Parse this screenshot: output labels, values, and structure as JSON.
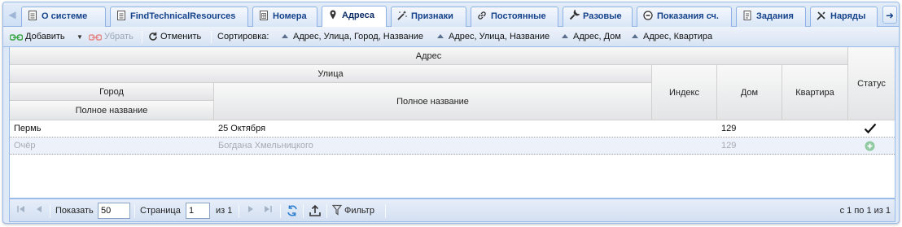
{
  "tabs": [
    {
      "label": "О системе",
      "icon": "document-icon"
    },
    {
      "label": "FindTechnicalResources",
      "icon": "document-icon"
    },
    {
      "label": "Номера",
      "icon": "grid-document-icon"
    },
    {
      "label": "Адреса",
      "icon": "map-pin-icon",
      "active": true
    },
    {
      "label": "Признаки",
      "icon": "magic-wand-icon"
    },
    {
      "label": "Постоянные",
      "icon": "link-icon"
    },
    {
      "label": "Разовые",
      "icon": "wrench-icon"
    },
    {
      "label": "Показания сч.",
      "icon": "meter-icon"
    },
    {
      "label": "Задания",
      "icon": "task-list-icon"
    },
    {
      "label": "Наряды",
      "icon": "tools-icon"
    }
  ],
  "toolbar": {
    "add_label": "Добавить",
    "remove_label": "Убрать",
    "cancel_label": "Отменить",
    "sort_label": "Сортировка:",
    "sort_options": [
      "Адрес, Улица, Город, Название",
      "Адрес, Улица, Название",
      "Адрес, Дом",
      "Адрес, Квартира"
    ]
  },
  "grid": {
    "headers": {
      "address": "Адрес",
      "street": "Улица",
      "city": "Город",
      "city_full_name": "Полное название",
      "street_full_name": "Полное название",
      "index": "Индекс",
      "house": "Дом",
      "apartment": "Квартира",
      "status": "Статус"
    },
    "rows": [
      {
        "city": "Пермь",
        "street": "25 Октября",
        "index": "",
        "house": "129",
        "apartment": "",
        "status_icon": "checkmark-icon"
      },
      {
        "city": "Очёр",
        "street": "Богдана Хмельницкого",
        "index": "",
        "house": "129",
        "apartment": "",
        "status_icon": "add-circle-icon"
      }
    ]
  },
  "paging": {
    "show_label": "Показать",
    "page_size": "50",
    "page_label": "Страница",
    "page_value": "1",
    "of_label": "из 1",
    "filter_label": "Фильтр",
    "summary": "с 1 по 1 из 1"
  },
  "colors": {
    "accent": "#15428b",
    "border": "#99bbe8",
    "add_green": "#3ea84a",
    "status_add": "#8fcaa0"
  }
}
